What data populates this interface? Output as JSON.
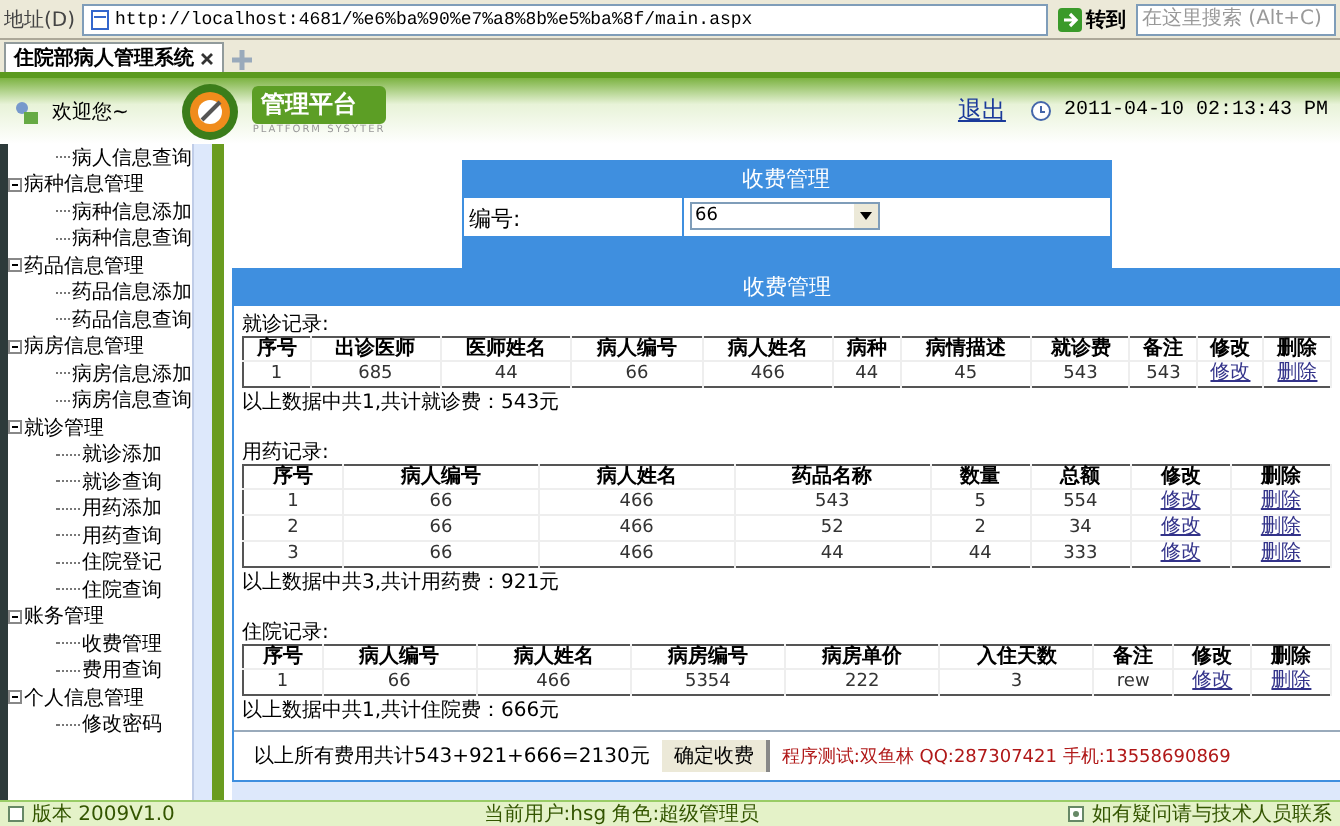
{
  "browser": {
    "address_label": "地址(D)",
    "url": "http://localhost:4681/%e6%ba%90%e7%a8%8b%e5%ba%8f/main.aspx",
    "go": "转到",
    "search_placeholder": "在这里搜索 (Alt+C)",
    "tab_title": "住院部病人管理系统"
  },
  "header": {
    "welcome": "欢迎您~",
    "logo_title": "管理平台",
    "logo_subtitle": "PLATFORM SYSYTER",
    "logout": "退出",
    "datetime": "2011-04-10 02:13:43 PM"
  },
  "sidebar": {
    "items": [
      {
        "label": "病人信息查询"
      },
      {
        "label": "病种信息管理",
        "expanded": true,
        "children": [
          {
            "label": "病种信息添加"
          },
          {
            "label": "病种信息查询"
          }
        ]
      },
      {
        "label": "药品信息管理",
        "expanded": true,
        "children": [
          {
            "label": "药品信息添加"
          },
          {
            "label": "药品信息查询"
          }
        ]
      },
      {
        "label": "病房信息管理",
        "expanded": true,
        "children": [
          {
            "label": "病房信息添加"
          },
          {
            "label": "病房信息查询"
          }
        ]
      },
      {
        "label": "就诊管理",
        "expanded": true,
        "children": [
          {
            "label": "就诊添加"
          },
          {
            "label": "就诊查询"
          },
          {
            "label": "用药添加"
          },
          {
            "label": "用药查询"
          },
          {
            "label": "住院登记"
          },
          {
            "label": "住院查询"
          }
        ]
      },
      {
        "label": "账务管理",
        "expanded": true,
        "children": [
          {
            "label": "收费管理"
          },
          {
            "label": "费用查询"
          }
        ]
      },
      {
        "label": "个人信息管理",
        "expanded": true,
        "children": [
          {
            "label": "修改密码"
          }
        ]
      }
    ]
  },
  "form": {
    "title": "收费管理",
    "label": "编号:",
    "value": "66"
  },
  "records": {
    "title": "收费管理",
    "sections": [
      {
        "heading": "就诊记录:",
        "columns": [
          "序号",
          "出诊医师",
          "医师姓名",
          "病人编号",
          "病人姓名",
          "病种",
          "病情描述",
          "就诊费",
          "备注",
          "修改",
          "删除"
        ],
        "rows": [
          {
            "cells": [
              "1",
              "685",
              "44",
              "66",
              "466",
              "44",
              "45",
              "543",
              "543"
            ],
            "actions": [
              "修改",
              "删除"
            ]
          }
        ],
        "summary": "以上数据中共1,共计就诊费：543元"
      },
      {
        "heading": "用药记录:",
        "columns": [
          "序号",
          "病人编号",
          "病人姓名",
          "药品名称",
          "数量",
          "总额",
          "修改",
          "删除"
        ],
        "rows": [
          {
            "cells": [
              "1",
              "66",
              "466",
              "543",
              "5",
              "554"
            ],
            "actions": [
              "修改",
              "删除"
            ]
          },
          {
            "cells": [
              "2",
              "66",
              "466",
              "52",
              "2",
              "34"
            ],
            "actions": [
              "修改",
              "删除"
            ]
          },
          {
            "cells": [
              "3",
              "66",
              "466",
              "44",
              "44",
              "333"
            ],
            "actions": [
              "修改",
              "删除"
            ]
          }
        ],
        "summary": "以上数据中共3,共计用药费：921元"
      },
      {
        "heading": "住院记录:",
        "columns": [
          "序号",
          "病人编号",
          "病人姓名",
          "病房编号",
          "病房单价",
          "入住天数",
          "备注",
          "修改",
          "删除"
        ],
        "rows": [
          {
            "cells": [
              "1",
              "66",
              "466",
              "5354",
              "222",
              "3",
              "rew"
            ],
            "actions": [
              "修改",
              "删除"
            ]
          }
        ],
        "summary": "以上数据中共1,共计住院费：666元"
      }
    ]
  },
  "footer": {
    "total": "以上所有费用共计543+921+666=2130元",
    "button": "确定收费",
    "credit": "程序测试:双鱼林 QQ:287307421 手机:13558690869"
  },
  "status_bar": {
    "version": "版本 2009V1.0",
    "user": "当前用户:hsg 角色:超级管理员",
    "help": "如有疑问请与技术人员联系"
  }
}
